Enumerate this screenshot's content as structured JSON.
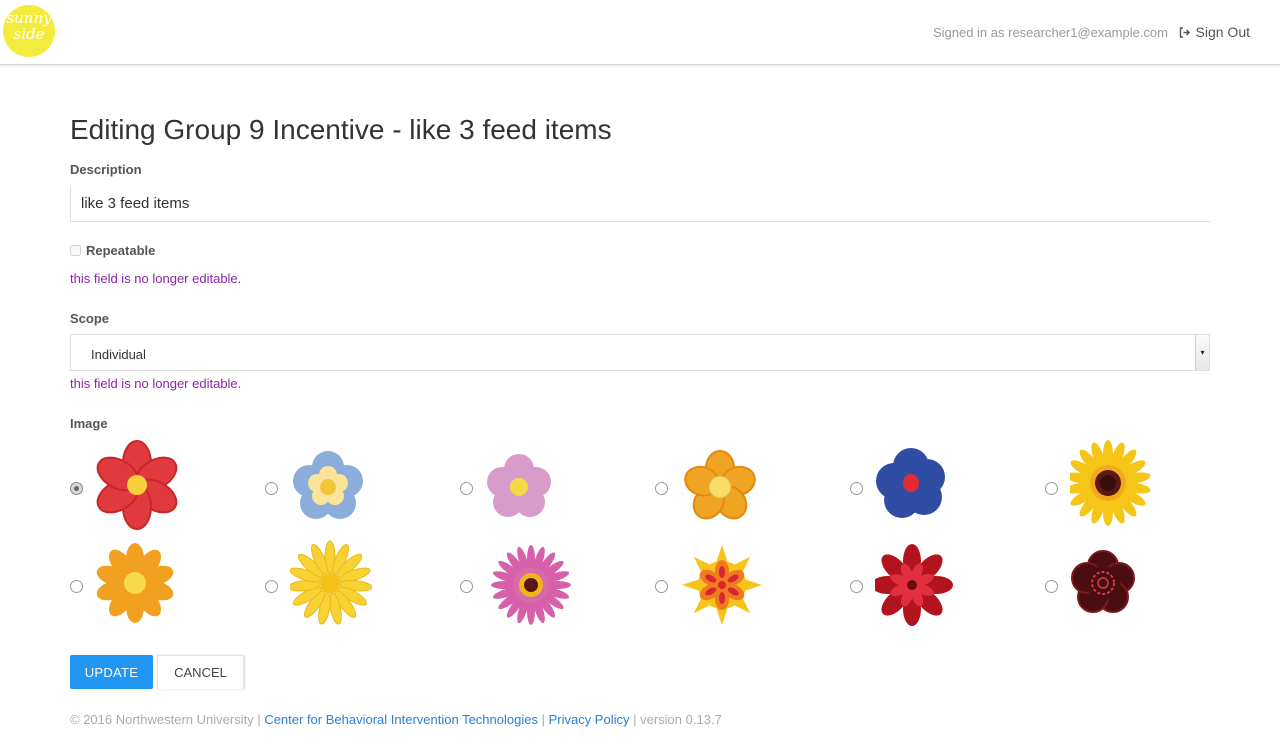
{
  "nav": {
    "logo_text_line1": "sunny",
    "logo_text_line2": "side",
    "signed_in_text": "Signed in as researcher1@example.com",
    "sign_out_label": "Sign Out"
  },
  "page": {
    "title": "Editing Group 9 Incentive - like 3 feed items"
  },
  "form": {
    "description_label": "Description",
    "description_value": "like 3 feed items",
    "repeatable_label": "Repeatable",
    "repeatable_checked": false,
    "repeatable_note": "this field is no longer editable.",
    "scope_label": "Scope",
    "scope_value": "Individual",
    "scope_note": "this field is no longer editable.",
    "image_label": "Image",
    "images": [
      {
        "name": "red-flower",
        "selected": true
      },
      {
        "name": "blue-flower",
        "selected": false
      },
      {
        "name": "pink-flower",
        "selected": false
      },
      {
        "name": "orange-flower",
        "selected": false
      },
      {
        "name": "navy-flower",
        "selected": false
      },
      {
        "name": "sunflower",
        "selected": false
      },
      {
        "name": "orange-daisy",
        "selected": false
      },
      {
        "name": "yellow-daisy",
        "selected": false
      },
      {
        "name": "pink-daisy",
        "selected": false
      },
      {
        "name": "yellow-red-flower",
        "selected": false
      },
      {
        "name": "crimson-flower",
        "selected": false
      },
      {
        "name": "dark-red-flower",
        "selected": false
      }
    ],
    "update_label": "UPDATE",
    "cancel_label": "CANCEL"
  },
  "footer": {
    "copyright": "© 2016 Northwestern University | ",
    "cbit_link": "Center for Behavioral Intervention Technologies",
    "sep1": " | ",
    "privacy_link": "Privacy Policy",
    "version": " | version 0.13.7"
  },
  "colors": {
    "primary": "#2196f3",
    "note": "#8e24aa",
    "link": "#2b7fd4",
    "logo": "#f4ec3c"
  }
}
